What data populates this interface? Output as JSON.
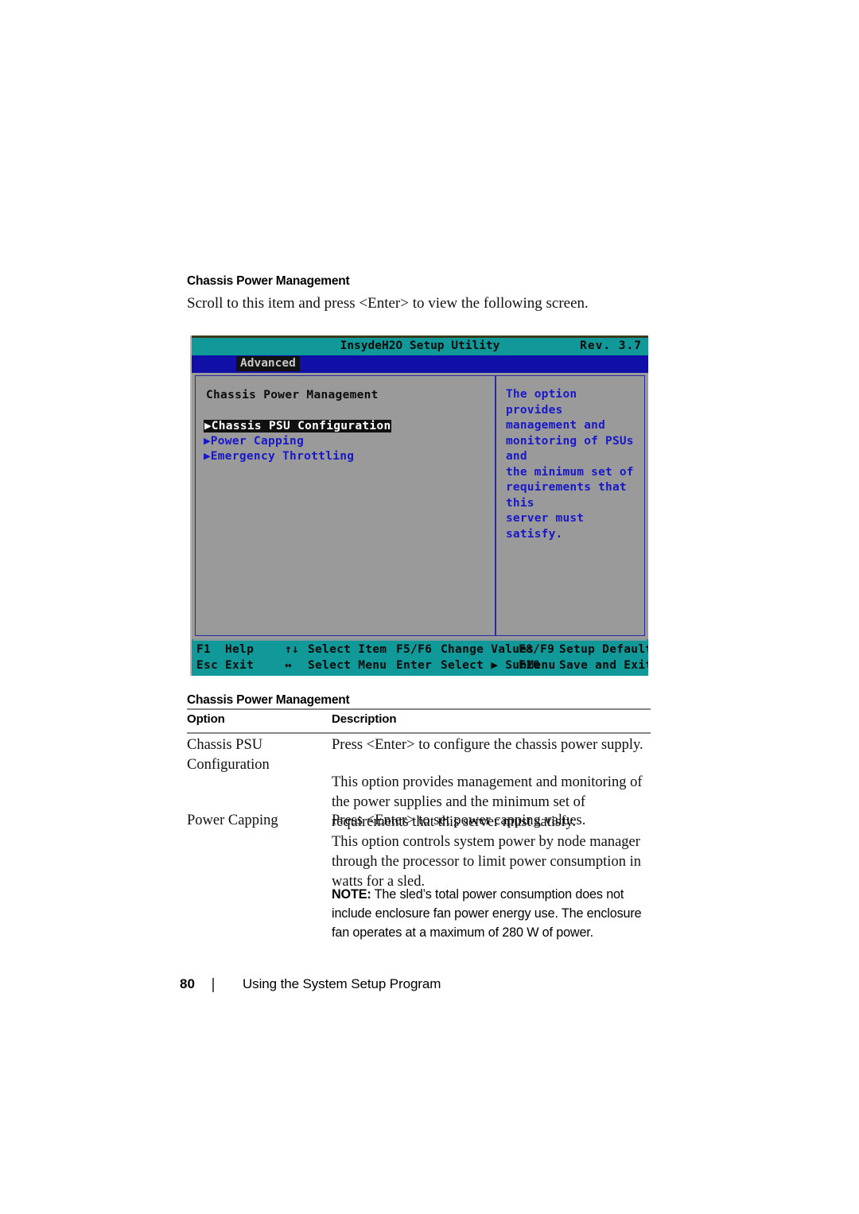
{
  "document": {
    "section_heading": "Chassis Power Management",
    "intro_text": "Scroll to this item and press <Enter> to view the following screen."
  },
  "bios_screen": {
    "title": "InsydeH2O Setup Utility",
    "revision": "Rev. 3.7",
    "active_menu": "Advanced",
    "panel_title": "Chassis Power Management",
    "menu_items": [
      {
        "label": "Chassis PSU Configuration",
        "selected": true
      },
      {
        "label": "Power Capping",
        "selected": false
      },
      {
        "label": "Emergency Throttling",
        "selected": false
      }
    ],
    "help_text": "The option provides\nmanagement and\nmonitoring of PSUs and\nthe minimum set of\nrequirements that this\nserver must satisfy.",
    "footer_keys": {
      "row1": [
        {
          "key": "F1",
          "action": "Help"
        },
        {
          "key": "↑↓",
          "action": "Select Item"
        },
        {
          "key": "F5/F6",
          "action": "Change Values"
        },
        {
          "key": "F8/F9",
          "action": "Setup Defaults"
        }
      ],
      "row2": [
        {
          "key": "Esc",
          "action": "Exit"
        },
        {
          "key": "↔",
          "action": "Select Menu"
        },
        {
          "key": "Enter",
          "action": "Select ▶ SubMenu"
        },
        {
          "key": "F10",
          "action": "Save and Exit"
        }
      ]
    },
    "colors": {
      "title_bar": "#119898",
      "menu_bar": "#1010a8",
      "panel_bg": "#9a9a9a",
      "text_blue": "#1818c8",
      "highlight_bg": "#101010"
    }
  },
  "table": {
    "heading": "Chassis Power Management",
    "columns": [
      "Option",
      "Description"
    ],
    "rows": [
      {
        "option": "Chassis PSU\nConfiguration",
        "description_1": "Press <Enter> to configure the chassis power supply.",
        "description_2": "This option provides management and monitoring of the power supplies and the minimum set of requirements that this server must satisfy."
      },
      {
        "option": "Power Capping",
        "description_1": "Press <Enter> to set power capping values.",
        "description_2": "This option controls system power by node manager through the processor to limit power consumption in watts for a sled.",
        "note_label": "NOTE:",
        "note_text": " The sled’s total power consumption does not include enclosure fan power energy use. The enclosure fan operates at a maximum of 280 W of power."
      }
    ]
  },
  "page_footer": {
    "page_number": "80",
    "running_head": "Using the System Setup Program"
  }
}
